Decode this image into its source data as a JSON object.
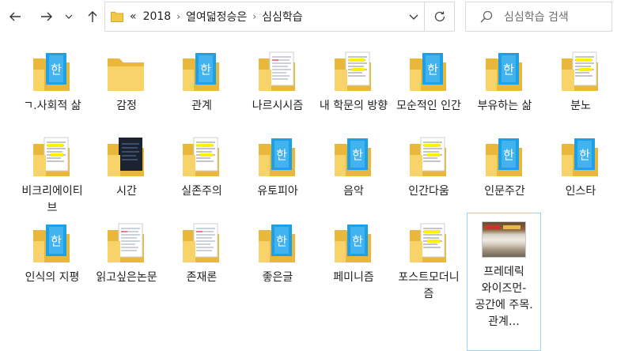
{
  "nav": {
    "back_icon": "arrow-left-icon",
    "forward_icon": "arrow-right-icon",
    "recent_icon": "chevron-down-icon",
    "up_icon": "arrow-up-icon"
  },
  "address": {
    "overflow": "«",
    "crumbs": [
      "2018",
      "열여덟정승은",
      "심심학습"
    ],
    "separator": "›"
  },
  "search": {
    "placeholder": "심심학습 검색"
  },
  "items": [
    {
      "label": "ㄱ.사회적 삶",
      "icon": "hangul-doc-folder"
    },
    {
      "label": "감정",
      "icon": "folder-empty"
    },
    {
      "label": "관계",
      "icon": "hangul-doc-folder"
    },
    {
      "label": "나르시시즘",
      "icon": "document-folder"
    },
    {
      "label": "내 학문의 방향",
      "icon": "highlight-folder"
    },
    {
      "label": "모순적인 인간",
      "icon": "hangul-doc-folder"
    },
    {
      "label": "부유하는 삶",
      "icon": "hangul-doc-folder"
    },
    {
      "label": "분노",
      "icon": "highlight-folder"
    },
    {
      "label": "비크리에이티브",
      "icon": "highlight-folder"
    },
    {
      "label": "시간",
      "icon": "dark-doc-folder"
    },
    {
      "label": "실존주의",
      "icon": "highlight-folder"
    },
    {
      "label": "유토피아",
      "icon": "hangul-doc-folder"
    },
    {
      "label": "음악",
      "icon": "hangul-doc-folder"
    },
    {
      "label": "인간다움",
      "icon": "highlight-folder"
    },
    {
      "label": "인문주간",
      "icon": "hangul-doc-folder"
    },
    {
      "label": "인스타",
      "icon": "hangul-doc-folder"
    },
    {
      "label": "인식의 지평",
      "icon": "hangul-doc-folder"
    },
    {
      "label": "읽고싶은논문",
      "icon": "document-folder"
    },
    {
      "label": "존재론",
      "icon": "document-folder"
    },
    {
      "label": "좋은글",
      "icon": "hangul-doc-folder"
    },
    {
      "label": "페미니즘",
      "icon": "hangul-doc-folder"
    },
    {
      "label": "포스트모더니즘",
      "icon": "highlight-folder"
    },
    {
      "label": "프레데릭 와이즈먼-공간에 주목. 관계…",
      "icon": "image-thumbnail"
    }
  ],
  "colors": {
    "folder": "#f2c84b",
    "folder_back": "#e9b83a",
    "hangul_doc": "#1ea0e6",
    "highlight": "#fff200",
    "selection_border": "#99d1ff"
  }
}
